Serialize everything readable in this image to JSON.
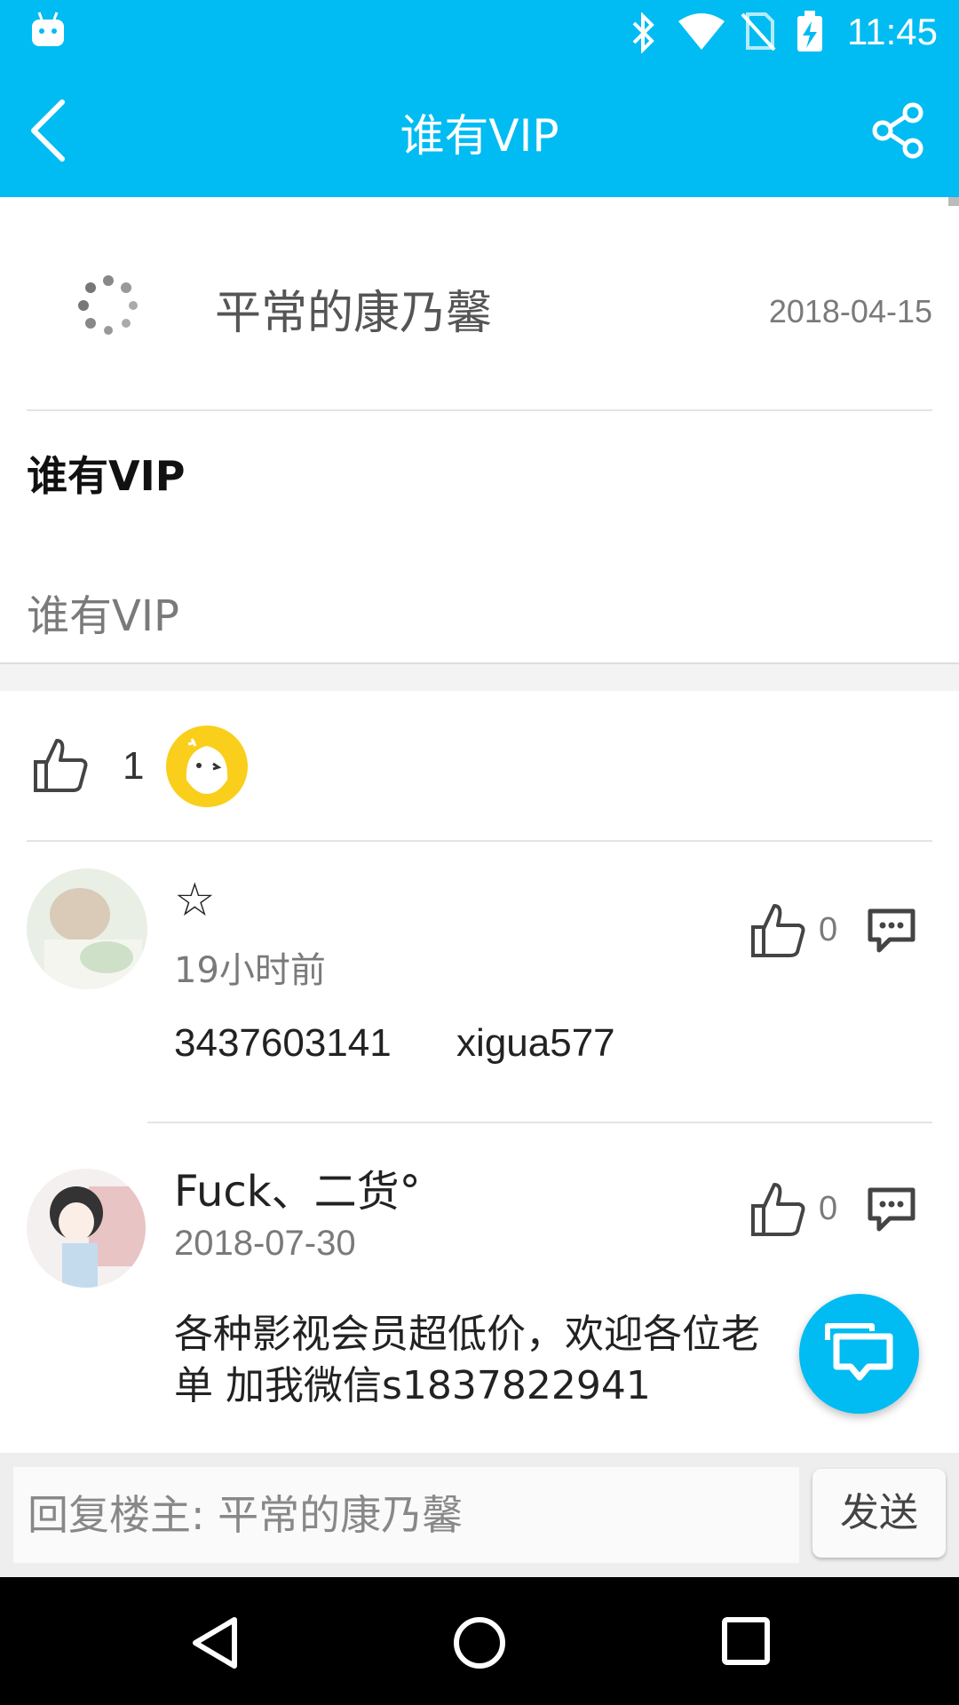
{
  "status_bar": {
    "time": "11:45",
    "icons": [
      "android-icon",
      "bluetooth-icon",
      "wifi-icon",
      "no-sim-icon",
      "battery-charging-icon"
    ]
  },
  "header": {
    "title": "谁有VIP",
    "back_icon": "chevron-left-icon",
    "share_icon": "share-icon"
  },
  "post": {
    "author": "平常的康乃馨",
    "date": "2018-04-15",
    "title": "谁有VIP",
    "body": "谁有VIP"
  },
  "likes": {
    "count": "1"
  },
  "comments": [
    {
      "username": "☆",
      "time": "19小时前",
      "like_count": "0",
      "content": "3437603141      xigua577"
    },
    {
      "username": "Fuck、二货°",
      "time": "2018-07-30",
      "like_count": "0",
      "content_line1": "各种影视会员超低价，欢迎各位老",
      "content_line2": "单 加我微信s1837822941"
    }
  ],
  "reply": {
    "placeholder": "回复楼主: 平常的康乃馨",
    "send_label": "发送"
  },
  "colors": {
    "accent": "#00bcf2",
    "like_avatar": "#f9cf1c"
  }
}
